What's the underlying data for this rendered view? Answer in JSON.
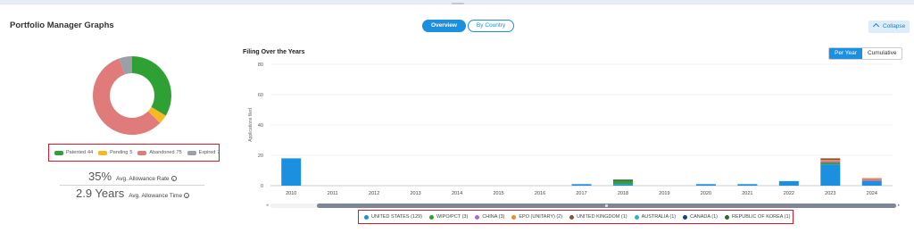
{
  "panel": {
    "title": "Portfolio Manager Graphs"
  },
  "tabs": [
    {
      "label": "Overview",
      "active": true
    },
    {
      "label": "By Country",
      "active": false
    }
  ],
  "collapse_label": "Collapse",
  "status_chart": {
    "type": "pie",
    "legend": [
      {
        "label": "Patented",
        "count": "44",
        "color": "#2fa134"
      },
      {
        "label": "Pending",
        "count": "5",
        "color": "#f7b825"
      },
      {
        "label": "Abandoned",
        "count": "75",
        "color": "#df7b7b"
      },
      {
        "label": "Expired",
        "count": "7",
        "color": "#9aa0a6"
      }
    ]
  },
  "stats": {
    "allowance_rate_value": "35%",
    "allowance_rate_label": "Avg. Allowance Rate",
    "allowance_time_value": "2.9 Years",
    "allowance_time_label": "Avg. Allowance Time"
  },
  "filing_chart": {
    "title": "Filing Over the Years",
    "buttons": [
      {
        "label": "Per Year",
        "active": true
      },
      {
        "label": "Cumulative",
        "active": false
      }
    ]
  },
  "chart_data": {
    "type": "bar",
    "title": "Filing Over the Years",
    "ylabel": "Applications filed",
    "xlabel": "",
    "ylim": [
      0,
      80
    ],
    "yticks": [
      0,
      20,
      40,
      60,
      80
    ],
    "categories": [
      "2010",
      "2011",
      "2012",
      "2013",
      "2014",
      "2015",
      "2016",
      "2017",
      "2018",
      "2019",
      "2020",
      "2021",
      "2022",
      "2023",
      "2024"
    ],
    "stacked": true,
    "series": [
      {
        "name": "UNITED STATES (129)",
        "color": "#1b8fe0",
        "values": [
          18,
          0,
          0,
          0,
          0,
          0,
          0,
          1,
          1,
          0,
          1,
          1,
          3,
          14,
          3
        ]
      },
      {
        "name": "WIPO/PCT (3)",
        "color": "#2fa134",
        "values": [
          0,
          0,
          0,
          0,
          0,
          0,
          0,
          0,
          2,
          0,
          0,
          0,
          0,
          1,
          0
        ]
      },
      {
        "name": "CHINA (3)",
        "color": "#a56cd6",
        "values": [
          0,
          0,
          0,
          0,
          0,
          0,
          0,
          0,
          0,
          0,
          0,
          0,
          0,
          1,
          1
        ]
      },
      {
        "name": "EPO (UNITARY) (2)",
        "color": "#f18a1f",
        "values": [
          0,
          0,
          0,
          0,
          0,
          0,
          0,
          0,
          0,
          0,
          0,
          0,
          0,
          1,
          1
        ]
      },
      {
        "name": "UNITED KINGDOM (1)",
        "color": "#8d4f3c",
        "values": [
          0,
          0,
          0,
          0,
          0,
          0,
          0,
          0,
          0,
          0,
          0,
          0,
          0,
          1,
          0
        ]
      },
      {
        "name": "AUSTRALIA (1)",
        "color": "#1fb9c8",
        "values": [
          0,
          0,
          0,
          0,
          0,
          0,
          0,
          0,
          0,
          0,
          0,
          0,
          0,
          0,
          0
        ]
      },
      {
        "name": "CANADA (1)",
        "color": "#1b3f8c",
        "values": [
          0,
          0,
          0,
          0,
          0,
          0,
          0,
          0,
          0,
          0,
          0,
          0,
          0,
          0,
          0
        ]
      },
      {
        "name": "REPUBLIC OF KOREA (1)",
        "color": "#2e6b2e",
        "values": [
          0,
          0,
          0,
          0,
          0,
          0,
          0,
          0,
          1,
          0,
          0,
          0,
          0,
          0,
          0
        ]
      }
    ]
  }
}
